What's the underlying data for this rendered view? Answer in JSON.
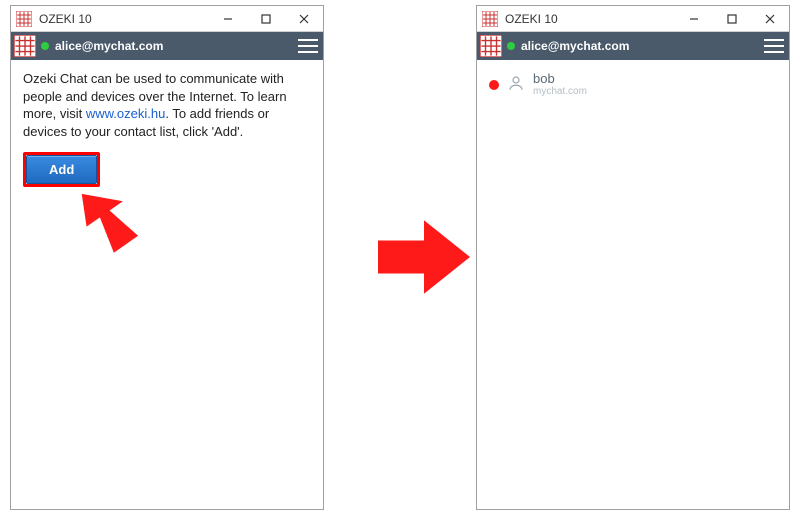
{
  "left": {
    "title": "OZEKI 10",
    "header_user": "alice@mychat.com",
    "intro_pre": "Ozeki Chat can be used to communicate with people and devices over the Internet. To learn more, visit ",
    "intro_link": "www.ozeki.hu",
    "intro_post": ". To add friends or devices to your contact list, click 'Add'.",
    "add_label": "Add"
  },
  "right": {
    "title": "OZEKI 10",
    "header_user": "alice@mychat.com",
    "contact": {
      "name": "bob",
      "host": "mychat.com"
    }
  }
}
